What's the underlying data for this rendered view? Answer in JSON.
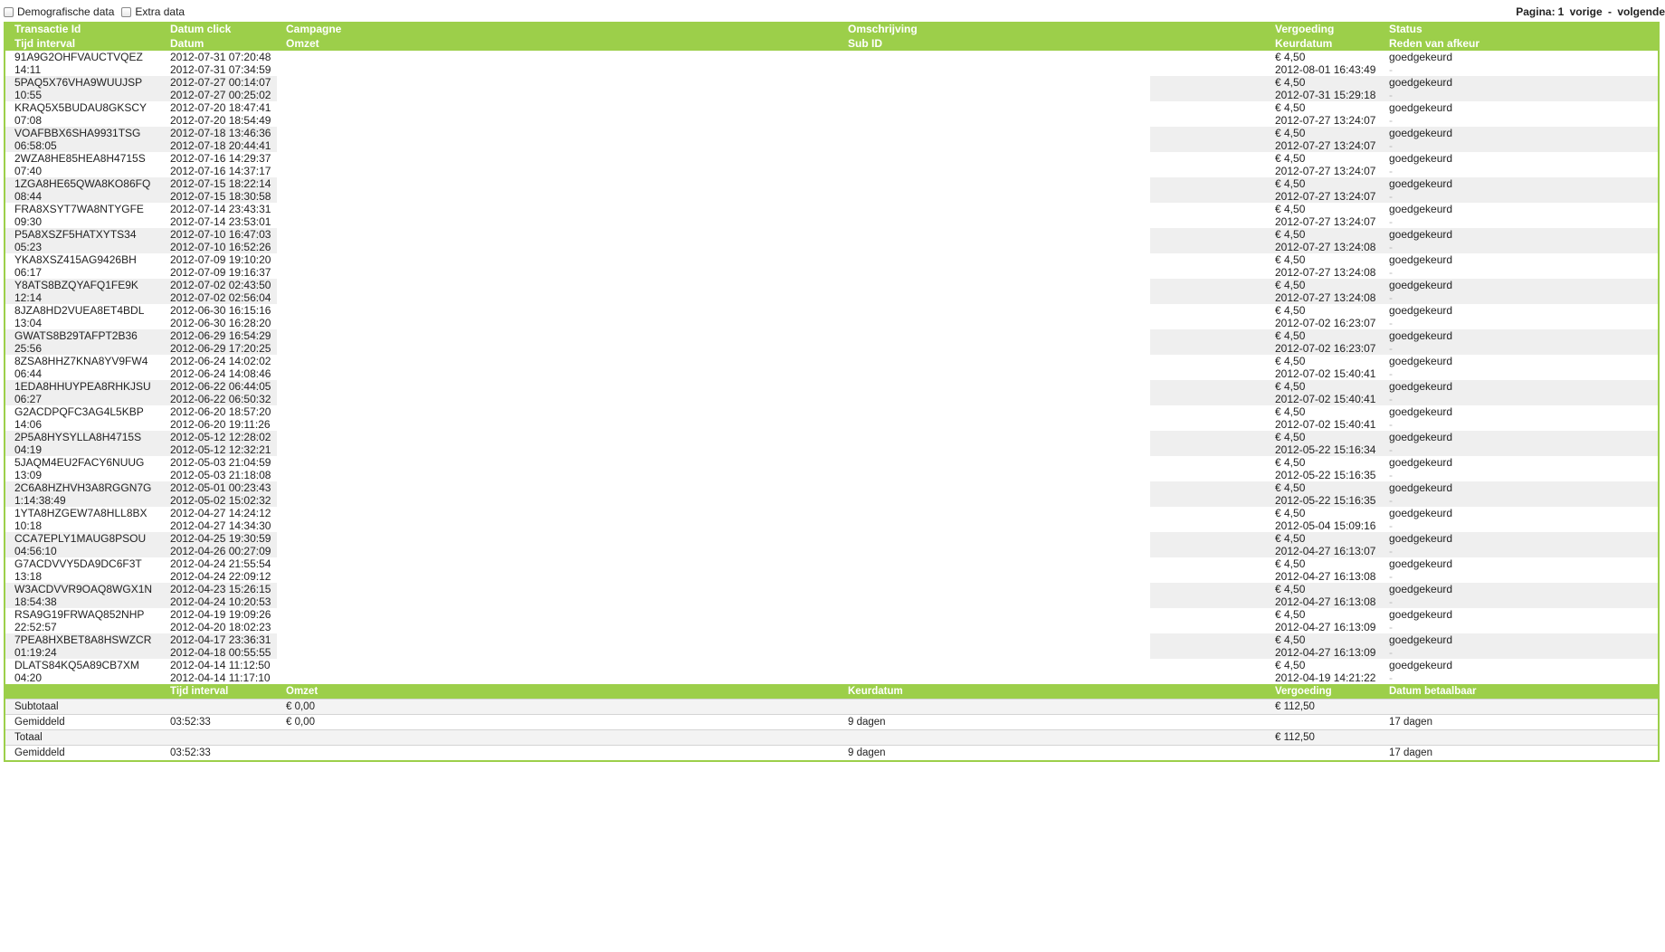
{
  "filters": {
    "demografisch_label": "Demografische data",
    "extra_label": "Extra data"
  },
  "pager": {
    "label": "Pagina:",
    "page": "1",
    "prev": "vorige",
    "sep": "-",
    "next": "volgende"
  },
  "columns": {
    "row1": [
      "Transactie Id",
      "Datum click",
      "Campagne",
      "Omschrijving",
      "Vergoeding",
      "Status"
    ],
    "row2": [
      "Tijd interval",
      "Datum",
      "Omzet",
      "Sub ID",
      "Keurdatum",
      "Reden van afkeur"
    ]
  },
  "rows": [
    {
      "id": "91A9G2OHFVAUCTVQEZ",
      "interval": "14:11",
      "click": "2012-07-31 07:20:48",
      "datum": "2012-07-31 07:34:59",
      "vergoeding": "€ 4,50",
      "keurdatum": "2012-08-01 16:43:49",
      "status": "goedgekeurd",
      "reden": "-"
    },
    {
      "id": "5PAQ5X76VHA9WUUJSP",
      "interval": "10:55",
      "click": "2012-07-27 00:14:07",
      "datum": "2012-07-27 00:25:02",
      "vergoeding": "€ 4,50",
      "keurdatum": "2012-07-31 15:29:18",
      "status": "goedgekeurd",
      "reden": "-"
    },
    {
      "id": "KRAQ5X5BUDAU8GKSCY",
      "interval": "07:08",
      "click": "2012-07-20 18:47:41",
      "datum": "2012-07-20 18:54:49",
      "vergoeding": "€ 4,50",
      "keurdatum": "2012-07-27 13:24:07",
      "status": "goedgekeurd",
      "reden": "-"
    },
    {
      "id": "VOAFBBX6SHA9931TSG",
      "interval": "06:58:05",
      "click": "2012-07-18 13:46:36",
      "datum": "2012-07-18 20:44:41",
      "vergoeding": "€ 4,50",
      "keurdatum": "2012-07-27 13:24:07",
      "status": "goedgekeurd",
      "reden": "-"
    },
    {
      "id": "2WZA8HE85HEA8H4715S",
      "interval": "07:40",
      "click": "2012-07-16 14:29:37",
      "datum": "2012-07-16 14:37:17",
      "vergoeding": "€ 4,50",
      "keurdatum": "2012-07-27 13:24:07",
      "status": "goedgekeurd",
      "reden": "-"
    },
    {
      "id": "1ZGA8HE65QWA8KO86FQ",
      "interval": "08:44",
      "click": "2012-07-15 18:22:14",
      "datum": "2012-07-15 18:30:58",
      "vergoeding": "€ 4,50",
      "keurdatum": "2012-07-27 13:24:07",
      "status": "goedgekeurd",
      "reden": "-"
    },
    {
      "id": "FRA8XSYT7WA8NTYGFE",
      "interval": "09:30",
      "click": "2012-07-14 23:43:31",
      "datum": "2012-07-14 23:53:01",
      "vergoeding": "€ 4,50",
      "keurdatum": "2012-07-27 13:24:07",
      "status": "goedgekeurd",
      "reden": "-"
    },
    {
      "id": "P5A8XSZF5HATXYTS34",
      "interval": "05:23",
      "click": "2012-07-10 16:47:03",
      "datum": "2012-07-10 16:52:26",
      "vergoeding": "€ 4,50",
      "keurdatum": "2012-07-27 13:24:08",
      "status": "goedgekeurd",
      "reden": "-"
    },
    {
      "id": "YKA8XSZ415AG9426BH",
      "interval": "06:17",
      "click": "2012-07-09 19:10:20",
      "datum": "2012-07-09 19:16:37",
      "vergoeding": "€ 4,50",
      "keurdatum": "2012-07-27 13:24:08",
      "status": "goedgekeurd",
      "reden": "-"
    },
    {
      "id": "Y8ATS8BZQYAFQ1FE9K",
      "interval": "12:14",
      "click": "2012-07-02 02:43:50",
      "datum": "2012-07-02 02:56:04",
      "vergoeding": "€ 4,50",
      "keurdatum": "2012-07-27 13:24:08",
      "status": "goedgekeurd",
      "reden": "-"
    },
    {
      "id": "8JZA8HD2VUEA8ET4BDL",
      "interval": "13:04",
      "click": "2012-06-30 16:15:16",
      "datum": "2012-06-30 16:28:20",
      "vergoeding": "€ 4,50",
      "keurdatum": "2012-07-02 16:23:07",
      "status": "goedgekeurd",
      "reden": "-"
    },
    {
      "id": "GWATS8B29TAFPT2B36",
      "interval": "25:56",
      "click": "2012-06-29 16:54:29",
      "datum": "2012-06-29 17:20:25",
      "vergoeding": "€ 4,50",
      "keurdatum": "2012-07-02 16:23:07",
      "status": "goedgekeurd",
      "reden": "-"
    },
    {
      "id": "8ZSA8HHZ7KNA8YV9FW4",
      "interval": "06:44",
      "click": "2012-06-24 14:02:02",
      "datum": "2012-06-24 14:08:46",
      "vergoeding": "€ 4,50",
      "keurdatum": "2012-07-02 15:40:41",
      "status": "goedgekeurd",
      "reden": "-"
    },
    {
      "id": "1EDA8HHUYPEA8RHKJSU",
      "interval": "06:27",
      "click": "2012-06-22 06:44:05",
      "datum": "2012-06-22 06:50:32",
      "vergoeding": "€ 4,50",
      "keurdatum": "2012-07-02 15:40:41",
      "status": "goedgekeurd",
      "reden": "-"
    },
    {
      "id": "G2ACDPQFC3AG4L5KBP",
      "interval": "14:06",
      "click": "2012-06-20 18:57:20",
      "datum": "2012-06-20 19:11:26",
      "vergoeding": "€ 4,50",
      "keurdatum": "2012-07-02 15:40:41",
      "status": "goedgekeurd",
      "reden": "-"
    },
    {
      "id": "2P5A8HYSYLLA8H4715S",
      "interval": "04:19",
      "click": "2012-05-12 12:28:02",
      "datum": "2012-05-12 12:32:21",
      "vergoeding": "€ 4,50",
      "keurdatum": "2012-05-22 15:16:34",
      "status": "goedgekeurd",
      "reden": "-"
    },
    {
      "id": "5JAQM4EU2FACY6NUUG",
      "interval": "13:09",
      "click": "2012-05-03 21:04:59",
      "datum": "2012-05-03 21:18:08",
      "vergoeding": "€ 4,50",
      "keurdatum": "2012-05-22 15:16:35",
      "status": "goedgekeurd",
      "reden": "-"
    },
    {
      "id": "2C6A8HZHVH3A8RGGN7G",
      "interval": "1:14:38:49",
      "click": "2012-05-01 00:23:43",
      "datum": "2012-05-02 15:02:32",
      "vergoeding": "€ 4,50",
      "keurdatum": "2012-05-22 15:16:35",
      "status": "goedgekeurd",
      "reden": "-"
    },
    {
      "id": "1YTA8HZGEW7A8HLL8BX",
      "interval": "10:18",
      "click": "2012-04-27 14:24:12",
      "datum": "2012-04-27 14:34:30",
      "vergoeding": "€ 4,50",
      "keurdatum": "2012-05-04 15:09:16",
      "status": "goedgekeurd",
      "reden": "-"
    },
    {
      "id": "CCA7EPLY1MAUG8PSOU",
      "interval": "04:56:10",
      "click": "2012-04-25 19:30:59",
      "datum": "2012-04-26 00:27:09",
      "vergoeding": "€ 4,50",
      "keurdatum": "2012-04-27 16:13:07",
      "status": "goedgekeurd",
      "reden": "-"
    },
    {
      "id": "G7ACDVVY5DA9DC6F3T",
      "interval": "13:18",
      "click": "2012-04-24 21:55:54",
      "datum": "2012-04-24 22:09:12",
      "vergoeding": "€ 4,50",
      "keurdatum": "2012-04-27 16:13:08",
      "status": "goedgekeurd",
      "reden": "-"
    },
    {
      "id": "W3ACDVVR9OAQ8WGX1N",
      "interval": "18:54:38",
      "click": "2012-04-23 15:26:15",
      "datum": "2012-04-24 10:20:53",
      "vergoeding": "€ 4,50",
      "keurdatum": "2012-04-27 16:13:08",
      "status": "goedgekeurd",
      "reden": "-"
    },
    {
      "id": "RSA9G19FRWAQ852NHP",
      "interval": "22:52:57",
      "click": "2012-04-19 19:09:26",
      "datum": "2012-04-20 18:02:23",
      "vergoeding": "€ 4,50",
      "keurdatum": "2012-04-27 16:13:09",
      "status": "goedgekeurd",
      "reden": "-"
    },
    {
      "id": "7PEA8HXBET8A8HSWZCR",
      "interval": "01:19:24",
      "click": "2012-04-17 23:36:31",
      "datum": "2012-04-18 00:55:55",
      "vergoeding": "€ 4,50",
      "keurdatum": "2012-04-27 16:13:09",
      "status": "goedgekeurd",
      "reden": "-"
    },
    {
      "id": "DLATS84KQ5A89CB7XM",
      "interval": "04:20",
      "click": "2012-04-14 11:12:50",
      "datum": "2012-04-14 11:17:10",
      "vergoeding": "€ 4,50",
      "keurdatum": "2012-04-19 14:21:22",
      "status": "goedgekeurd",
      "reden": "-"
    }
  ],
  "footer": {
    "headers": [
      "",
      "Tijd interval",
      "Omzet",
      "Keurdatum",
      "Vergoeding",
      "Datum betaalbaar"
    ],
    "rows": [
      [
        "Subtotaal",
        "",
        "€ 0,00",
        "",
        "€ 112,50",
        ""
      ],
      [
        "Gemiddeld",
        "03:52:33",
        "€ 0,00",
        "9 dagen",
        "",
        "17 dagen"
      ],
      [
        "Totaal",
        "",
        "",
        "",
        "€ 112,50",
        ""
      ],
      [
        "Gemiddeld",
        "03:52:33",
        "",
        "9 dagen",
        "",
        "17 dagen"
      ]
    ]
  }
}
